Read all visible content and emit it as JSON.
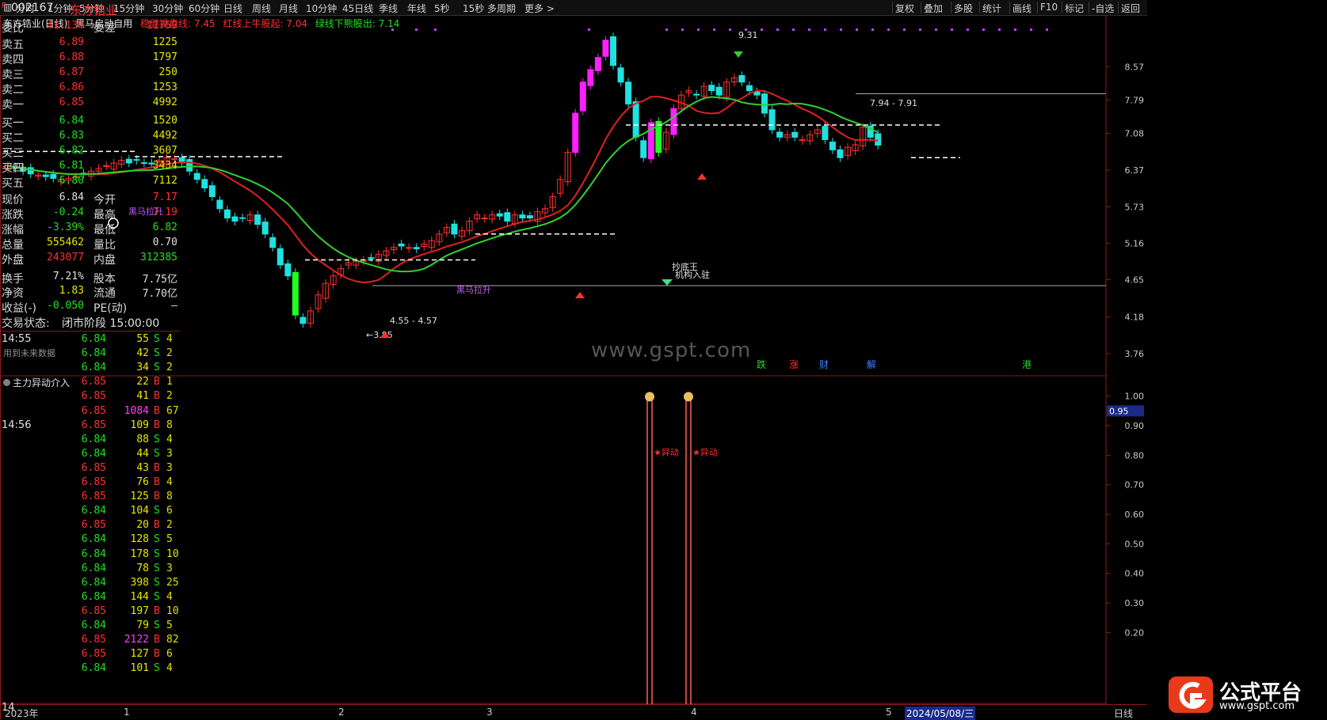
{
  "toolbar": {
    "items": [
      "分时",
      "1分钟",
      "5分钟",
      "15分钟",
      "30分钟",
      "60分钟",
      "日线",
      "周线",
      "月线",
      "10分钟",
      "45日线",
      "季线",
      "年线",
      "5秒",
      "15秒",
      "多周期",
      "更多 >"
    ],
    "right_items": [
      "复权",
      "叠加",
      "多股",
      "统计",
      "画线",
      "F10",
      "标记",
      "-自选",
      "返回"
    ]
  },
  "main_chart": {
    "stock_title": "东方锆业(日线)",
    "indicator_name": "黑马启动自用",
    "line1": "稳健操盘线: 7.45",
    "line2": "红线上牛股起: 7.04",
    "line3": "绿线下熊股出: 7.14",
    "y_axis": [
      "8.57",
      "7.79",
      "7.08",
      "6.37",
      "5.73",
      "5.16",
      "4.65",
      "4.18",
      "3.76"
    ],
    "annotations": {
      "high": "9.31",
      "low": "←3.85",
      "range1": "4.55 - 4.57",
      "range2": "7.94 - 7.91",
      "label_heima": "黑马拉升",
      "label_bottom": "抄底王",
      "label_jigou": "机构入驻",
      "label_future": "用到未来数据",
      "label_lakai": "黑马拉升"
    },
    "event_markers": [
      "跌",
      "涨",
      "财",
      "解",
      "港"
    ],
    "watermark": "www.gspt.com"
  },
  "sub_chart": {
    "title": "主力异动介入",
    "y_axis": [
      "1.00",
      "0.90",
      "0.80",
      "0.70",
      "0.60",
      "0.50",
      "0.40",
      "0.30",
      "0.20"
    ],
    "current_value": "0.95",
    "signal_label": "★异动"
  },
  "bottom_axis": {
    "labels": [
      "2023年",
      "1",
      "2",
      "3",
      "4",
      "5"
    ],
    "cursor_date": "2024/05/08/三",
    "period": "日线"
  },
  "quote": {
    "code": "002167",
    "name": "东方锆业",
    "r_badge": "R",
    "weibi_label": "委比",
    "weibi": "41.13%",
    "weicha_label": "委差",
    "weicha": "11759",
    "asks": [
      {
        "label": "卖五",
        "price": "6.89",
        "vol": "1225"
      },
      {
        "label": "卖四",
        "price": "6.88",
        "vol": "1797"
      },
      {
        "label": "卖三",
        "price": "6.87",
        "vol": "250"
      },
      {
        "label": "卖二",
        "price": "6.86",
        "vol": "1253"
      },
      {
        "label": "卖一",
        "price": "6.85",
        "vol": "4992"
      }
    ],
    "bids": [
      {
        "label": "买一",
        "price": "6.84",
        "vol": "1520"
      },
      {
        "label": "买二",
        "price": "6.83",
        "vol": "4492"
      },
      {
        "label": "买三",
        "price": "6.82",
        "vol": "3607"
      },
      {
        "label": "买四",
        "price": "6.81",
        "vol": "3434"
      },
      {
        "label": "买五",
        "price": "6.80",
        "vol": "7112"
      }
    ],
    "stats": [
      {
        "l1": "现价",
        "v1": "6.84",
        "l2": "今开",
        "v2": "7.17"
      },
      {
        "l1": "涨跌",
        "v1": "-0.24",
        "l2": "最高",
        "v2": "7.19"
      },
      {
        "l1": "涨幅",
        "v1": "-3.39%",
        "l2": "最低",
        "v2": "6.82"
      },
      {
        "l1": "总量",
        "v1": "555462",
        "l2": "量比",
        "v2": "0.70"
      },
      {
        "l1": "外盘",
        "v1": "243077",
        "l2": "内盘",
        "v2": "312385"
      },
      {
        "l1": "换手",
        "v1": "7.21%",
        "l2": "股本",
        "v2": "7.75亿"
      },
      {
        "l1": "净资",
        "v1": "1.83",
        "l2": "流通",
        "v2": "7.70亿"
      },
      {
        "l1": "收益(-)",
        "v1": "-0.050",
        "l2": "PE(动)",
        "v2": "—"
      }
    ],
    "status_label": "交易状态:",
    "status": "闭市阶段 15:00:00",
    "ticks": [
      {
        "time": "14:55",
        "price": "6.84",
        "vol": "55",
        "side": "S",
        "extra": "4"
      },
      {
        "time": "",
        "price": "6.84",
        "vol": "42",
        "side": "S",
        "extra": "2"
      },
      {
        "time": "",
        "price": "6.84",
        "vol": "34",
        "side": "S",
        "extra": "2"
      },
      {
        "time": "",
        "price": "6.85",
        "vol": "22",
        "side": "B",
        "extra": "1"
      },
      {
        "time": "",
        "price": "6.85",
        "vol": "41",
        "side": "B",
        "extra": "2"
      },
      {
        "time": "",
        "price": "6.85",
        "vol": "1084",
        "side": "B",
        "extra": "67"
      },
      {
        "time": "14:56",
        "price": "6.85",
        "vol": "109",
        "side": "B",
        "extra": "8"
      },
      {
        "time": "",
        "price": "6.84",
        "vol": "88",
        "side": "S",
        "extra": "4"
      },
      {
        "time": "",
        "price": "6.84",
        "vol": "44",
        "side": "S",
        "extra": "3"
      },
      {
        "time": "",
        "price": "6.85",
        "vol": "43",
        "side": "B",
        "extra": "3"
      },
      {
        "time": "",
        "price": "6.85",
        "vol": "76",
        "side": "B",
        "extra": "4"
      },
      {
        "time": "",
        "price": "6.85",
        "vol": "125",
        "side": "B",
        "extra": "8"
      },
      {
        "time": "",
        "price": "6.84",
        "vol": "104",
        "side": "S",
        "extra": "6"
      },
      {
        "time": "",
        "price": "6.85",
        "vol": "20",
        "side": "B",
        "extra": "2"
      },
      {
        "time": "",
        "price": "6.84",
        "vol": "128",
        "side": "S",
        "extra": "5"
      },
      {
        "time": "",
        "price": "6.84",
        "vol": "178",
        "side": "S",
        "extra": "10"
      },
      {
        "time": "",
        "price": "6.84",
        "vol": "78",
        "side": "S",
        "extra": "3"
      },
      {
        "time": "",
        "price": "6.84",
        "vol": "398",
        "side": "S",
        "extra": "25"
      },
      {
        "time": "",
        "price": "6.84",
        "vol": "144",
        "side": "S",
        "extra": "4"
      },
      {
        "time": "",
        "price": "6.85",
        "vol": "197",
        "side": "B",
        "extra": "10"
      },
      {
        "time": "",
        "price": "6.84",
        "vol": "79",
        "side": "S",
        "extra": "5"
      },
      {
        "time": "",
        "price": "6.85",
        "vol": "2122",
        "side": "B",
        "extra": "82"
      },
      {
        "time": "",
        "price": "6.85",
        "vol": "127",
        "side": "B",
        "extra": "6"
      },
      {
        "time": "",
        "price": "6.84",
        "vol": "101",
        "side": "S",
        "extra": "4"
      }
    ],
    "bottom_time": "14",
    "logo_text": "公式平台",
    "logo_url": "www.gspt.com"
  },
  "colors": {
    "up": "#ff3030",
    "down": "#20e0e0",
    "magenta": "#ff20ff",
    "green_bar": "#20ff20",
    "red_line": "#e02020",
    "green_line": "#30d030",
    "frame": "#8a1a1a"
  }
}
